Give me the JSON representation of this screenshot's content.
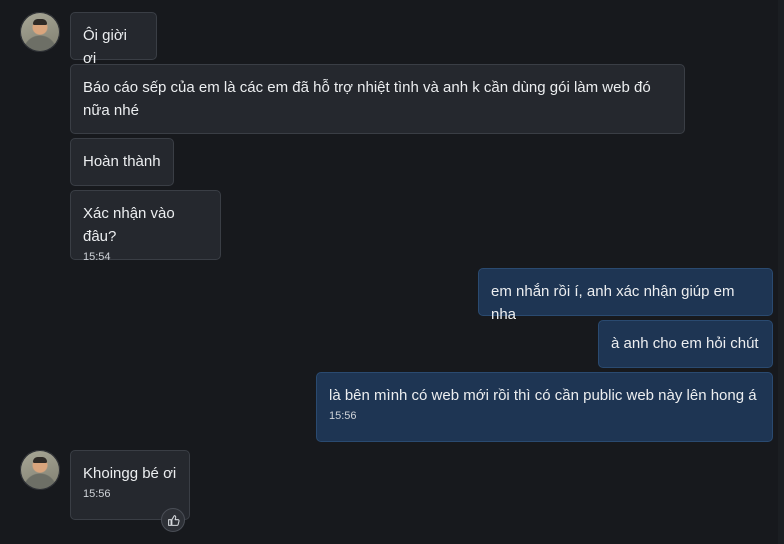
{
  "messages": [
    {
      "text": "Ôi giời ơi"
    },
    {
      "text": "Báo cáo sếp của em là các em đã hỗ trợ nhiệt tình và anh k cần dùng gói làm web đó nữa nhé"
    },
    {
      "text": "Hoàn thành"
    },
    {
      "text": "Xác nhận vào đâu?",
      "time": "15:54"
    },
    {
      "text": "em nhắn rồi í, anh xác nhận giúp em nha"
    },
    {
      "text": "à anh cho em hỏi chút"
    },
    {
      "text": "là bên mình có web mới rồi thì có cần public web này lên hong á",
      "time": "15:56"
    },
    {
      "text": "Khoingg bé ơi",
      "time": "15:56"
    }
  ],
  "icons": {
    "reaction": "thumbs-up-icon"
  },
  "colors": {
    "background": "#17191d",
    "incoming": "#25282e",
    "outgoing": "#1e3553"
  }
}
